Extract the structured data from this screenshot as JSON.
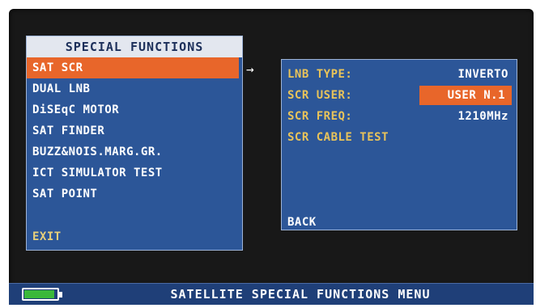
{
  "menu": {
    "title": "SPECIAL FUNCTIONS",
    "items": [
      {
        "label": "SAT SCR",
        "selected": true
      },
      {
        "label": "DUAL LNB"
      },
      {
        "label": "DiSEqC MOTOR"
      },
      {
        "label": "SAT FINDER"
      },
      {
        "label": "BUZZ&NOIS.MARG.GR."
      },
      {
        "label": "ICT SIMULATOR TEST"
      },
      {
        "label": "SAT POINT"
      }
    ],
    "exit_label": "EXIT"
  },
  "arrow_glyph": "→",
  "submenu": {
    "lnb_type": {
      "label": "LNB TYPE:",
      "value": "INVERTO"
    },
    "scr_user": {
      "label": "SCR USER:",
      "value": "USER N.1"
    },
    "scr_freq": {
      "label": "SCR FREQ:",
      "value": "1210MHz"
    },
    "scr_cable_test": {
      "label": "SCR CABLE TEST"
    },
    "back_label": "BACK"
  },
  "status_bar": {
    "text": "SATELLITE SPECIAL FUNCTIONS MENU",
    "battery_level": 0.92
  },
  "colors": {
    "panel": "#2c5698",
    "highlight": "#e8662a",
    "label_yellow": "#e8c35a",
    "battery_green": "#3ab83a"
  }
}
